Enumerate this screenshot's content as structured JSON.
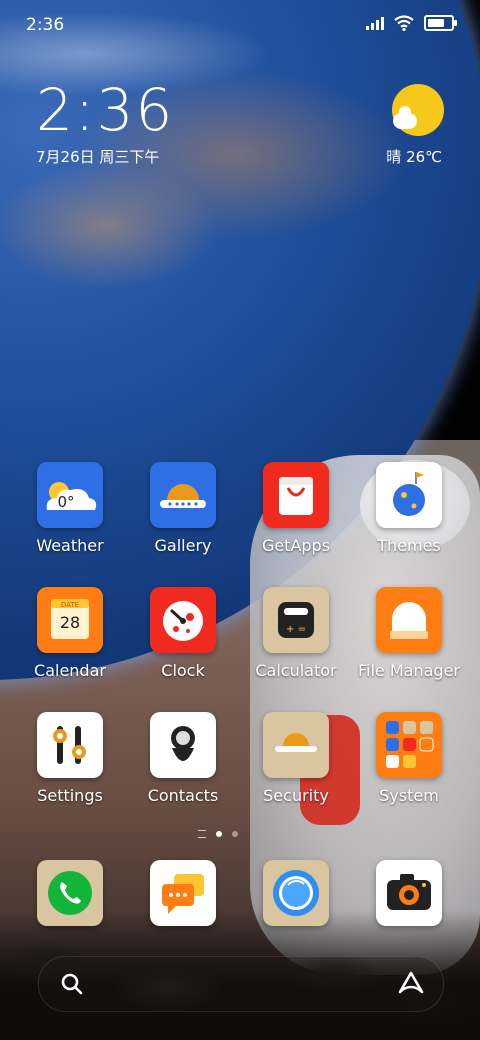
{
  "status_bar": {
    "time": "2:36",
    "icons": [
      "signal-icon",
      "wifi-icon",
      "battery-icon"
    ],
    "battery_level": 0.9
  },
  "clock_widget": {
    "time": "2:36",
    "date": "7月26日 周三下午"
  },
  "weather_widget": {
    "text": "晴 26℃",
    "icon": "sunny-cloud-icon"
  },
  "apps": [
    {
      "name": "weather",
      "label": "Weather",
      "bg": "#2f6fe6",
      "extra": "0°"
    },
    {
      "name": "gallery",
      "label": "Gallery",
      "bg": "#2f6fe6"
    },
    {
      "name": "getapps",
      "label": "GetApps",
      "bg": "#f02a1e"
    },
    {
      "name": "themes",
      "label": "Themes",
      "bg": "#ffffff"
    },
    {
      "name": "calendar",
      "label": "Calendar",
      "bg": "#ff7d12",
      "extra_top": "DATE",
      "extra": "28"
    },
    {
      "name": "clock",
      "label": "Clock",
      "bg": "#f02a1e"
    },
    {
      "name": "calculator",
      "label": "Calculator",
      "bg": "#d9c59f"
    },
    {
      "name": "file-manager",
      "label": "File Manager",
      "bg": "#ff7d12"
    },
    {
      "name": "settings",
      "label": "Settings",
      "bg": "#ffffff"
    },
    {
      "name": "contacts",
      "label": "Contacts",
      "bg": "#ffffff"
    },
    {
      "name": "security",
      "label": "Security",
      "bg": "#d9c59f"
    },
    {
      "name": "system",
      "label": "System",
      "bg": "#ff7d12"
    }
  ],
  "dock": [
    {
      "name": "phone",
      "bg": "#d9c59f"
    },
    {
      "name": "messages",
      "bg": "#ffffff"
    },
    {
      "name": "browser",
      "bg": "#d9c59f"
    },
    {
      "name": "camera",
      "bg": "#ffffff"
    }
  ],
  "page_indicator": {
    "pages": 2,
    "current": 1
  },
  "search_bar": {
    "left_icon": "search-icon",
    "right_icon": "assistant-icon"
  }
}
